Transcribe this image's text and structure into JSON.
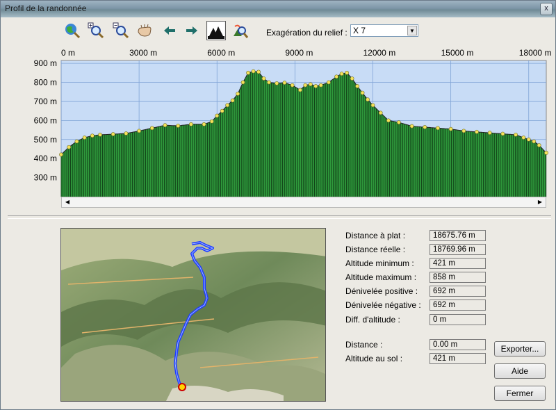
{
  "window": {
    "title": "Profil de la randonnée",
    "close_label": "x"
  },
  "toolbar": {
    "tools": [
      {
        "name": "globe-zoom-icon"
      },
      {
        "name": "zoom-in-icon"
      },
      {
        "name": "zoom-out-icon"
      },
      {
        "name": "hand-pan-icon"
      },
      {
        "name": "arrow-left-icon"
      },
      {
        "name": "arrow-right-icon"
      },
      {
        "name": "trees-terrain-icon"
      },
      {
        "name": "route-search-icon"
      }
    ],
    "relief_label": "Exagération du relief :",
    "relief_value": "X 7"
  },
  "chart_data": {
    "type": "area",
    "x_unit": "m",
    "y_unit": "m",
    "x_ticks": [
      "0 m",
      "3000 m",
      "6000 m",
      "9000 m",
      "12000 m",
      "15000 m",
      "18000 m"
    ],
    "y_ticks": [
      "300 m",
      "400 m",
      "500 m",
      "600 m",
      "700 m",
      "800 m",
      "900 m"
    ],
    "xlim": [
      0,
      18675.76
    ],
    "ylim": [
      200,
      915
    ],
    "grid": true,
    "fill_color": "#2f9a3c",
    "point_color": "#f4e25a",
    "background_color": "#c8dcf6",
    "series": [
      {
        "x": [
          0,
          300,
          600,
          900,
          1200,
          1500,
          2000,
          2500,
          3000,
          3500,
          4000,
          4500,
          5000,
          5500,
          5800,
          6000,
          6200,
          6400,
          6600,
          6800,
          7000,
          7200,
          7400,
          7600,
          7800,
          8000,
          8300,
          8600,
          8900,
          9200,
          9400,
          9600,
          9800,
          10000,
          10300,
          10600,
          10800,
          11000,
          11200,
          11400,
          11600,
          11800,
          12000,
          12300,
          12600,
          13000,
          13500,
          14000,
          14500,
          15000,
          15500,
          16000,
          16500,
          17000,
          17500,
          17800,
          18000,
          18200,
          18400,
          18675
        ],
        "y": [
          421,
          460,
          490,
          510,
          520,
          525,
          528,
          532,
          545,
          560,
          575,
          572,
          580,
          580,
          595,
          625,
          650,
          680,
          705,
          740,
          800,
          850,
          858,
          855,
          820,
          800,
          795,
          798,
          785,
          760,
          785,
          790,
          780,
          785,
          800,
          830,
          845,
          850,
          820,
          780,
          745,
          710,
          680,
          640,
          600,
          590,
          570,
          565,
          560,
          555,
          545,
          540,
          535,
          530,
          525,
          510,
          500,
          490,
          470,
          430
        ]
      }
    ]
  },
  "stats": [
    {
      "label": "Distance à plat :",
      "value": "18675.76 m"
    },
    {
      "label": "Distance réelle :",
      "value": "18769.96 m"
    },
    {
      "label": "Altitude minimum :",
      "value": "421 m"
    },
    {
      "label": "Altitude maximum :",
      "value": "858 m"
    },
    {
      "label": "Dénivelée positive :",
      "value": "692 m"
    },
    {
      "label": "Dénivelée négative :",
      "value": "692 m"
    },
    {
      "label": "Diff. d'altitude :",
      "value": "0 m"
    },
    {
      "label": "Distance :",
      "value": "0.00 m"
    },
    {
      "label": "Altitude au sol :",
      "value": "421 m"
    }
  ],
  "buttons": {
    "export": "Exporter...",
    "help": "Aide",
    "close": "Fermer"
  },
  "map": {
    "route_color": "#1e3cff",
    "start_marker": "start-marker-icon"
  }
}
